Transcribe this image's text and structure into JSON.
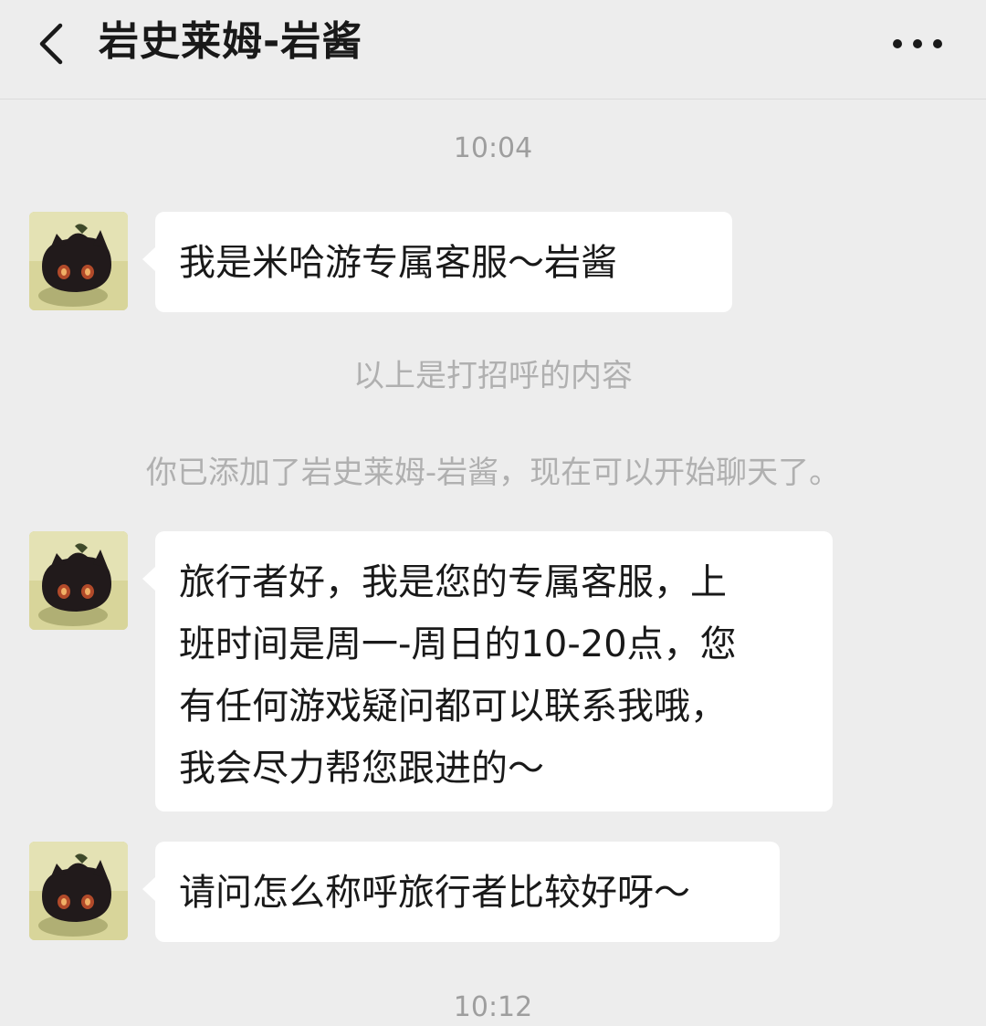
{
  "header": {
    "title": "岩史莱姆-岩酱"
  },
  "chat": {
    "time_1": "10:04",
    "message_1": "我是米哈游专属客服～岩酱",
    "system_1": "以上是打招呼的内容",
    "system_2": "你已添加了岩史莱姆-岩酱，现在可以开始聊天了。",
    "message_2": "旅行者好，我是您的专属客服，上\n班时间是周一-周日的10-20点，您\n有任何游戏疑问都可以联系我哦，\n我会尽力帮您跟进的～",
    "message_3": "请问怎么称呼旅行者比较好呀～",
    "time_2": "10:12"
  },
  "icons": {
    "back": "chevron-left-icon",
    "more": "more-dots-icon",
    "avatar": "slime-avatar"
  },
  "colors": {
    "background": "#ededed",
    "bubble": "#ffffff",
    "text": "#191919",
    "meta_text": "#a3a3a3"
  }
}
